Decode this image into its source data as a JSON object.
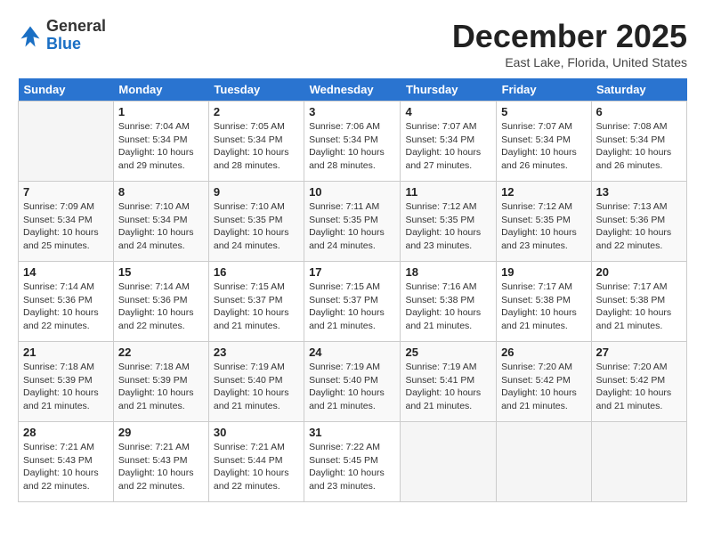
{
  "logo": {
    "line1": "General",
    "line2": "Blue"
  },
  "title": "December 2025",
  "location": "East Lake, Florida, United States",
  "headers": [
    "Sunday",
    "Monday",
    "Tuesday",
    "Wednesday",
    "Thursday",
    "Friday",
    "Saturday"
  ],
  "weeks": [
    [
      {
        "num": "",
        "info": ""
      },
      {
        "num": "1",
        "info": "Sunrise: 7:04 AM\nSunset: 5:34 PM\nDaylight: 10 hours\nand 29 minutes."
      },
      {
        "num": "2",
        "info": "Sunrise: 7:05 AM\nSunset: 5:34 PM\nDaylight: 10 hours\nand 28 minutes."
      },
      {
        "num": "3",
        "info": "Sunrise: 7:06 AM\nSunset: 5:34 PM\nDaylight: 10 hours\nand 28 minutes."
      },
      {
        "num": "4",
        "info": "Sunrise: 7:07 AM\nSunset: 5:34 PM\nDaylight: 10 hours\nand 27 minutes."
      },
      {
        "num": "5",
        "info": "Sunrise: 7:07 AM\nSunset: 5:34 PM\nDaylight: 10 hours\nand 26 minutes."
      },
      {
        "num": "6",
        "info": "Sunrise: 7:08 AM\nSunset: 5:34 PM\nDaylight: 10 hours\nand 26 minutes."
      }
    ],
    [
      {
        "num": "7",
        "info": "Sunrise: 7:09 AM\nSunset: 5:34 PM\nDaylight: 10 hours\nand 25 minutes."
      },
      {
        "num": "8",
        "info": "Sunrise: 7:10 AM\nSunset: 5:34 PM\nDaylight: 10 hours\nand 24 minutes."
      },
      {
        "num": "9",
        "info": "Sunrise: 7:10 AM\nSunset: 5:35 PM\nDaylight: 10 hours\nand 24 minutes."
      },
      {
        "num": "10",
        "info": "Sunrise: 7:11 AM\nSunset: 5:35 PM\nDaylight: 10 hours\nand 24 minutes."
      },
      {
        "num": "11",
        "info": "Sunrise: 7:12 AM\nSunset: 5:35 PM\nDaylight: 10 hours\nand 23 minutes."
      },
      {
        "num": "12",
        "info": "Sunrise: 7:12 AM\nSunset: 5:35 PM\nDaylight: 10 hours\nand 23 minutes."
      },
      {
        "num": "13",
        "info": "Sunrise: 7:13 AM\nSunset: 5:36 PM\nDaylight: 10 hours\nand 22 minutes."
      }
    ],
    [
      {
        "num": "14",
        "info": "Sunrise: 7:14 AM\nSunset: 5:36 PM\nDaylight: 10 hours\nand 22 minutes."
      },
      {
        "num": "15",
        "info": "Sunrise: 7:14 AM\nSunset: 5:36 PM\nDaylight: 10 hours\nand 22 minutes."
      },
      {
        "num": "16",
        "info": "Sunrise: 7:15 AM\nSunset: 5:37 PM\nDaylight: 10 hours\nand 21 minutes."
      },
      {
        "num": "17",
        "info": "Sunrise: 7:15 AM\nSunset: 5:37 PM\nDaylight: 10 hours\nand 21 minutes."
      },
      {
        "num": "18",
        "info": "Sunrise: 7:16 AM\nSunset: 5:38 PM\nDaylight: 10 hours\nand 21 minutes."
      },
      {
        "num": "19",
        "info": "Sunrise: 7:17 AM\nSunset: 5:38 PM\nDaylight: 10 hours\nand 21 minutes."
      },
      {
        "num": "20",
        "info": "Sunrise: 7:17 AM\nSunset: 5:38 PM\nDaylight: 10 hours\nand 21 minutes."
      }
    ],
    [
      {
        "num": "21",
        "info": "Sunrise: 7:18 AM\nSunset: 5:39 PM\nDaylight: 10 hours\nand 21 minutes."
      },
      {
        "num": "22",
        "info": "Sunrise: 7:18 AM\nSunset: 5:39 PM\nDaylight: 10 hours\nand 21 minutes."
      },
      {
        "num": "23",
        "info": "Sunrise: 7:19 AM\nSunset: 5:40 PM\nDaylight: 10 hours\nand 21 minutes."
      },
      {
        "num": "24",
        "info": "Sunrise: 7:19 AM\nSunset: 5:40 PM\nDaylight: 10 hours\nand 21 minutes."
      },
      {
        "num": "25",
        "info": "Sunrise: 7:19 AM\nSunset: 5:41 PM\nDaylight: 10 hours\nand 21 minutes."
      },
      {
        "num": "26",
        "info": "Sunrise: 7:20 AM\nSunset: 5:42 PM\nDaylight: 10 hours\nand 21 minutes."
      },
      {
        "num": "27",
        "info": "Sunrise: 7:20 AM\nSunset: 5:42 PM\nDaylight: 10 hours\nand 21 minutes."
      }
    ],
    [
      {
        "num": "28",
        "info": "Sunrise: 7:21 AM\nSunset: 5:43 PM\nDaylight: 10 hours\nand 22 minutes."
      },
      {
        "num": "29",
        "info": "Sunrise: 7:21 AM\nSunset: 5:43 PM\nDaylight: 10 hours\nand 22 minutes."
      },
      {
        "num": "30",
        "info": "Sunrise: 7:21 AM\nSunset: 5:44 PM\nDaylight: 10 hours\nand 22 minutes."
      },
      {
        "num": "31",
        "info": "Sunrise: 7:22 AM\nSunset: 5:45 PM\nDaylight: 10 hours\nand 23 minutes."
      },
      {
        "num": "",
        "info": ""
      },
      {
        "num": "",
        "info": ""
      },
      {
        "num": "",
        "info": ""
      }
    ]
  ]
}
